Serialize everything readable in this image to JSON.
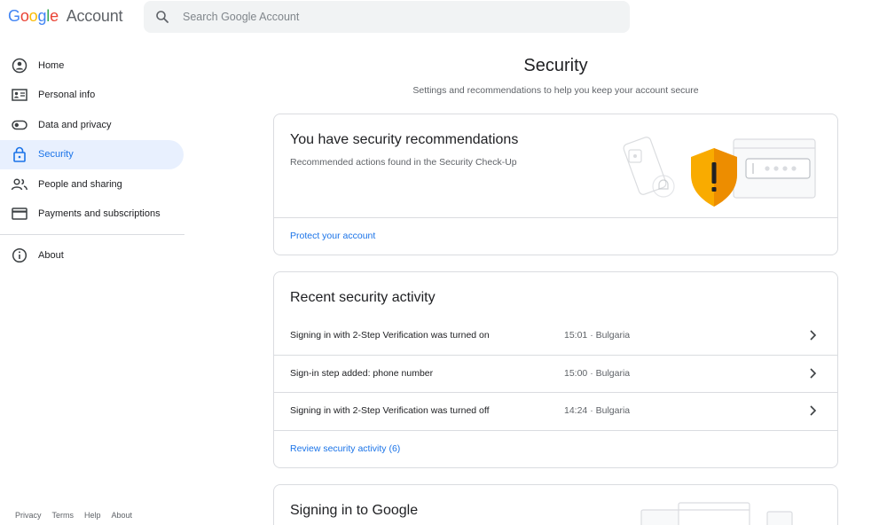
{
  "header": {
    "logo_google": "Google",
    "logo_account": "Account",
    "search_placeholder": "Search Google Account"
  },
  "sidebar": {
    "items": [
      {
        "label": "Home",
        "icon": "home-icon"
      },
      {
        "label": "Personal info",
        "icon": "id-card-icon"
      },
      {
        "label": "Data and privacy",
        "icon": "toggle-icon"
      },
      {
        "label": "Security",
        "icon": "lock-icon",
        "active": true
      },
      {
        "label": "People and sharing",
        "icon": "people-icon"
      },
      {
        "label": "Payments and subscriptions",
        "icon": "credit-card-icon"
      }
    ],
    "about": {
      "label": "About",
      "icon": "info-icon"
    }
  },
  "footer": {
    "links": [
      "Privacy",
      "Terms",
      "Help",
      "About"
    ]
  },
  "main": {
    "title": "Security",
    "subtitle": "Settings and recommendations to help you keep your account secure",
    "recommendations": {
      "title": "You have security recommendations",
      "description": "Recommended actions found in the Security Check-Up",
      "link": "Protect your account"
    },
    "activity": {
      "title": "Recent security activity",
      "rows": [
        {
          "description": "Signing in with 2-Step Verification was turned on",
          "time": "15:01 · Bulgaria"
        },
        {
          "description": "Sign-in step added: phone number",
          "time": "15:00 · Bulgaria"
        },
        {
          "description": "Signing in with 2-Step Verification was turned off",
          "time": "14:24 · Bulgaria"
        }
      ],
      "link": "Review security activity (6)"
    },
    "signing_in": {
      "title": "Signing in to Google"
    }
  },
  "colors": {
    "accent": "#1a73e8",
    "active_bg": "#e8f0fe",
    "shield": "#f9ab00",
    "shield_dark": "#e37400",
    "border": "#dadce0",
    "text_secondary": "#5f6368"
  }
}
